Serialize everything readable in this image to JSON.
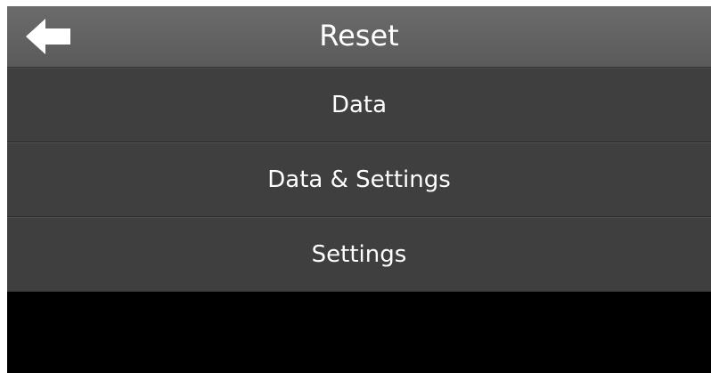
{
  "header": {
    "title": "Reset",
    "back_icon": "arrow-left-icon"
  },
  "menu": {
    "items": [
      {
        "label": "Data"
      },
      {
        "label": "Data & Settings"
      },
      {
        "label": "Settings"
      }
    ]
  },
  "colors": {
    "header_bg": "#626262",
    "item_bg": "#3f3f3f",
    "screen_bg": "#000000",
    "text": "#ffffff"
  }
}
